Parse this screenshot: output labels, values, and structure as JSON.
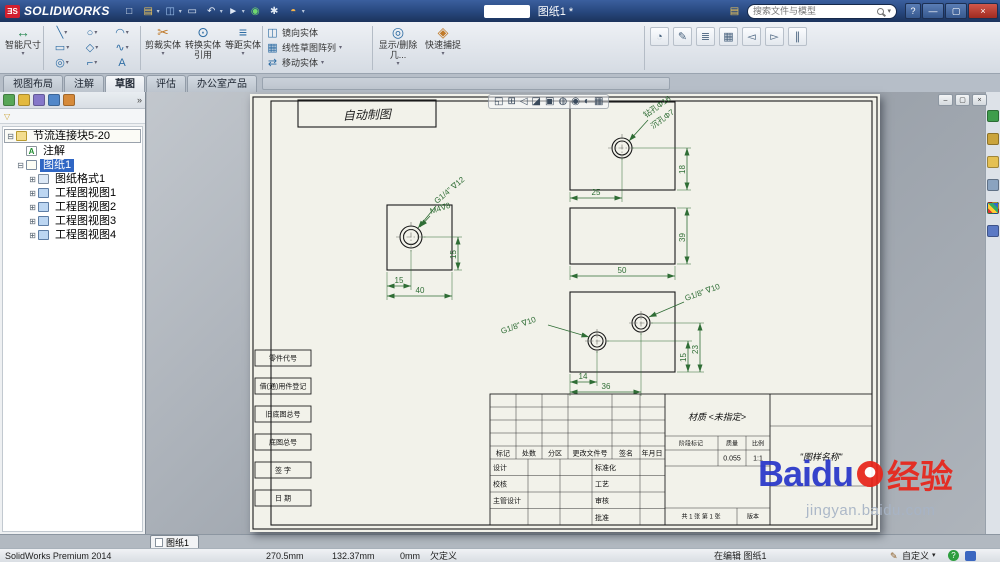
{
  "titlebar": {
    "app_name": "SOLIDWORKS",
    "doc_title": "图纸1 *",
    "search_placeholder": "搜索文件与模型",
    "window": {
      "help": "?",
      "minimize": "—",
      "maximize": "▢",
      "close": "×"
    }
  },
  "ribbon": {
    "smart_dimension": "智能尺寸",
    "trim": "剪裁实体",
    "convert": "转换实体引用",
    "offset": "等距实体",
    "mirror": "镜向实体",
    "linear_pattern": "线性草图阵列",
    "move": "移动实体",
    "display_delete": "显示/删除几...",
    "quick_snap": "快速捕捉"
  },
  "tabs": [
    {
      "label": "视图布局"
    },
    {
      "label": "注解"
    },
    {
      "label": "草图",
      "active": true
    },
    {
      "label": "评估"
    },
    {
      "label": "办公室产品"
    }
  ],
  "tree": {
    "root": {
      "label": "节流连接块5-20"
    },
    "items": [
      {
        "label": "注解"
      },
      {
        "label": "图纸1",
        "selected": true
      },
      {
        "label": "图纸格式1"
      },
      {
        "label": "工程图视图1"
      },
      {
        "label": "工程图视图2"
      },
      {
        "label": "工程图视图3"
      },
      {
        "label": "工程图视图4"
      }
    ]
  },
  "drawing": {
    "note": "自动制图",
    "views": {
      "view1": {
        "callout_thread": "G1/4\" ∇12",
        "callout_tap": "M4∇8",
        "dim_v": "15",
        "dim_h": "15",
        "dim_w": "40"
      },
      "view2": {
        "callout_drill": "钻孔Φ16",
        "callout_cbore": "沉孔Φ7",
        "dim_w": "25",
        "dim_h": "18"
      },
      "view3": {
        "dim_h": "39",
        "dim_w": "50"
      },
      "view4": {
        "callout_left": "G1/8\" ∇10",
        "callout_right": "G1/8\" ∇10",
        "dim_14": "14",
        "dim_36": "36",
        "dim_15": "15",
        "dim_23": "23"
      }
    },
    "margin_labels": [
      "零件代号",
      "借(通)用件登记",
      "旧底图总号",
      "底图总号",
      "签  字",
      "日  期"
    ],
    "title_block": {
      "material": "材质 <未指定>",
      "headers": [
        "标记",
        "处数",
        "分区",
        "更改文件号",
        "签名",
        "年月日"
      ],
      "roles": [
        "设计",
        "校核",
        "主管设计"
      ],
      "roles2": [
        "标准化",
        "工艺",
        "审核",
        "批准"
      ],
      "stage": "阶段标记",
      "mass_label": "质量",
      "scale_label": "比例",
      "mass": "0.055",
      "scale": "1:1",
      "sheets": "共 1 张 第 1 张",
      "version": "版本",
      "name": "\"图样名称\""
    }
  },
  "sheet_tab": {
    "label": "图纸1"
  },
  "statusbar": {
    "product": "SolidWorks Premium 2014",
    "x": "270.5mm",
    "y": "132.37mm",
    "z": "0mm",
    "state": "欠定义",
    "editing": "在编辑 图纸1",
    "customize": "自定义"
  },
  "watermark": {
    "brand": "Baidu",
    "brand_suffix": "经验",
    "url": "jingyan.baidu.com"
  },
  "colors": {
    "titlebar_blue": "#27477d",
    "dimension_green": "#2f6d35",
    "selection_blue": "#2f66c4",
    "baidu_blue": "#2836c9",
    "baidu_red": "#e8251a"
  }
}
